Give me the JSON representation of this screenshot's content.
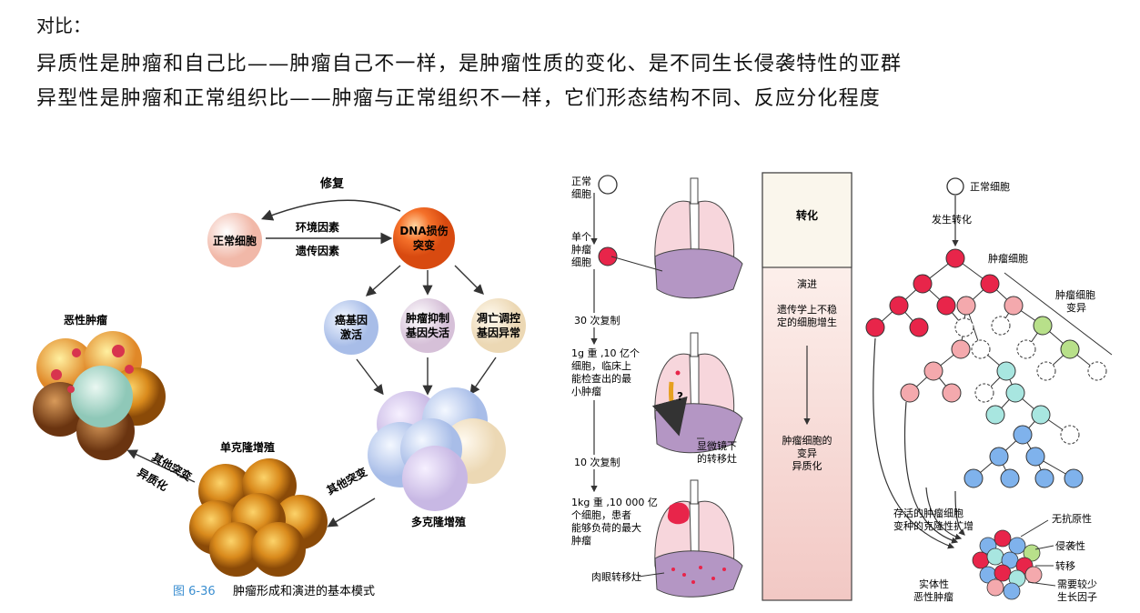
{
  "header": {
    "title": "对比：",
    "line1": "异质性是肿瘤和自己比——肿瘤自己不一样，是肿瘤性质的变化、是不同生长侵袭特性的亚群",
    "line2": "异型性是肿瘤和正常组织比——肿瘤与正常组织不一样，它们形态结构不同、反应分化程度"
  },
  "fig_left": {
    "repair": "修复",
    "normal_cell": "正常细胞",
    "env_factor": "环境因素",
    "gen_factor": "遗传因素",
    "dna_damage_1": "DNA损伤",
    "dna_damage_2": "突变",
    "onco_1": "癌基因",
    "onco_2": "激活",
    "supp_1": "肿瘤抑制",
    "supp_2": "基因失活",
    "apop_1": "凋亡调控",
    "apop_2": "基因异常",
    "poly_clone": "多克隆增殖",
    "other_mut": "其他突变",
    "mono_clone": "单克隆增殖",
    "other_mut2": "其他突变",
    "hetero": "异质化",
    "malignant": "恶性肿瘤",
    "caption_num": "图 6-36",
    "caption_text": "肿瘤形成和演进的基本模式"
  },
  "fig_mid": {
    "normal_cell_1": "正常",
    "normal_cell_2": "细胞",
    "single_1": "单个",
    "single_2": "肿瘤",
    "single_3": "细胞",
    "rep30": "30 次复制",
    "g1_1": "1g 重 ,10 亿个",
    "g1_2": "细胞，临床上",
    "g1_3": "能检查出的最",
    "g1_4": "小肿瘤",
    "micro_1": "显微镜下",
    "micro_2": "的转移灶",
    "rep10": "10 次复制",
    "kg1_1": "1kg 重 ,10 000 亿",
    "kg1_2": "个细胞，患者",
    "kg1_3": "能够负荷的最大",
    "kg1_4": "肿瘤",
    "gross": "肉眼转移灶",
    "qmark": "?"
  },
  "fig_box": {
    "transform": "转化",
    "progress": "演进",
    "unstable_1": "遗传学上不稳",
    "unstable_2": "定的细胞增生",
    "variant_1": "肿瘤细胞的",
    "variant_2": "变异",
    "variant_3": "异质化"
  },
  "fig_right": {
    "normal_cell": "正常细胞",
    "occur": "发生转化",
    "tumor_cell": "肿瘤细胞",
    "variant_1": "肿瘤细胞",
    "variant_2": "变异",
    "surviving_1": "存活的肿瘤细胞",
    "surviving_2": "变种的克隆性扩增",
    "no_antigen": "无抗原性",
    "invasive": "侵袭性",
    "metastasis": "转移",
    "less_gf_1": "需要较少",
    "less_gf_2": "生长因子",
    "solid_1": "实体性",
    "solid_2": "恶性肿瘤"
  },
  "colors": {
    "tumor_red": "#e8254a",
    "pink": "#f4a9ad",
    "green": "#b8e08a",
    "cyan": "#a8e6e0",
    "blue": "#7fb2ec",
    "dna_orange": "#ef6a1e",
    "caption_blue": "#3a8ed0"
  }
}
